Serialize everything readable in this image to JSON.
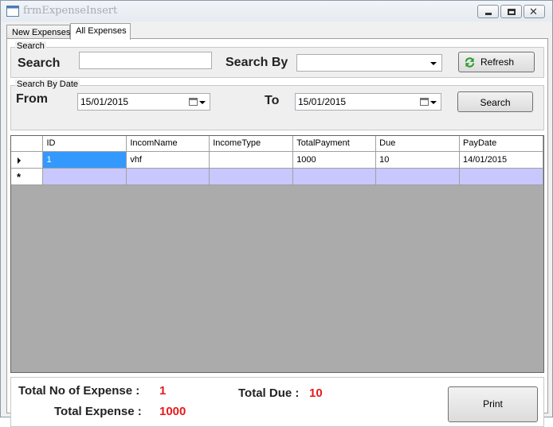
{
  "window": {
    "title": "frmExpenseInsert"
  },
  "tabs": [
    {
      "label": "New Expenses"
    },
    {
      "label": "All Expenses"
    }
  ],
  "search_group": {
    "legend": "Search",
    "search_label": "Search",
    "search_value": "",
    "search_by_label": "Search By",
    "search_by_value": "",
    "refresh_label": "Refresh"
  },
  "date_group": {
    "legend": "Search By Date",
    "from_label": "From",
    "from_value": "15/01/2015",
    "to_label": "To",
    "to_value": "15/01/2015",
    "search_button": "Search"
  },
  "grid": {
    "columns": [
      "ID",
      "IncomName",
      "IncomeType",
      "TotalPayment",
      "Due",
      "PayDate"
    ],
    "rows": [
      {
        "ID": "1",
        "IncomName": "vhf",
        "IncomeType": "",
        "TotalPayment": "1000",
        "Due": "10",
        "PayDate": "14/01/2015"
      }
    ],
    "new_row_marker": "*"
  },
  "summary": {
    "total_no_label": "Total No of Expense :",
    "total_no_value": "1",
    "total_expense_label": "Total Expense :",
    "total_expense_value": "1000",
    "total_due_label": "Total Due :",
    "total_due_value": "10",
    "print_label": "Print"
  },
  "colors": {
    "accent_value": "#e51b1b",
    "selection": "#3399ff",
    "new_row": "#c8c8ff",
    "grid_background": "#ababab"
  },
  "icons": {
    "app": "window-app-icon",
    "refresh": "refresh-icon",
    "calendar": "calendar-icon"
  }
}
